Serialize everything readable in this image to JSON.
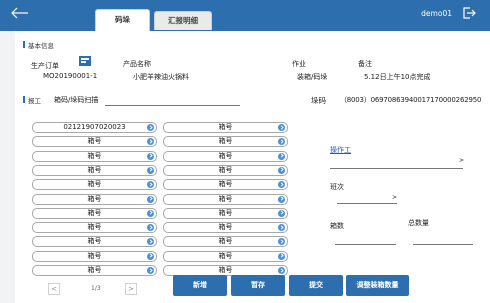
{
  "header": {
    "back_icon": "back-arrow-icon",
    "tabs": [
      {
        "label": "码垛"
      },
      {
        "label": "汇报明细"
      }
    ],
    "user": "demo01",
    "logout_icon": "logout-icon"
  },
  "basic_info": {
    "section_title": "基本信息",
    "order_label": "生产订单",
    "order_value": "MO20190001-1",
    "product_label": "产品名称",
    "product_value": "小肥羊辣油火锅料",
    "job_label": "作业",
    "job_value": "装箱/码垛",
    "remark_label": "备注",
    "remark_value": "5.12日上午10点完成"
  },
  "report": {
    "section_title": "报工",
    "scan_label": "箱码/垛码扫描",
    "pallet_label": "垛码",
    "pallet_value": "（8003）06970863940017170000262950"
  },
  "boxes": {
    "left": [
      "02121907020023",
      "箱号",
      "箱号",
      "箱号",
      "箱号",
      "箱号",
      "箱号",
      "箱号",
      "箱号",
      "箱号",
      "箱号"
    ],
    "right": [
      "箱号",
      "箱号",
      "箱号",
      "箱号",
      "箱号",
      "箱号",
      "箱号",
      "箱号",
      "箱号",
      "箱号",
      "箱号"
    ]
  },
  "side": {
    "operator_label": "操作工",
    "operator_arrow": ">",
    "shift_label": "班次",
    "shift_arrow": ">",
    "box_count_label": "箱数",
    "total_label": "总数量"
  },
  "pager": {
    "prev": "<",
    "page": "1/3",
    "next": ">"
  },
  "actions": {
    "add": "新增",
    "hold": "暂存",
    "submit": "提交",
    "adjust": "调整装箱数量"
  },
  "colors": {
    "header_bg": "#2d6fae",
    "button_bg": "#2d6fae",
    "link": "#2a55c8"
  }
}
